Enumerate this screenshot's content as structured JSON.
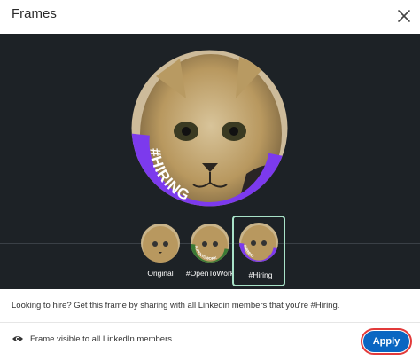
{
  "dialog": {
    "title": "Frames",
    "close_icon": "close-icon"
  },
  "preview": {
    "frame_text": "#HIRING",
    "frame_color": "#7c3aed"
  },
  "frames": [
    {
      "label": "Original",
      "selected": false
    },
    {
      "label": "#OpenToWork",
      "ring_text": "#OPENTOWORK",
      "selected": false
    },
    {
      "label": "#Hiring",
      "ring_text": "#HIRING",
      "selected": true
    }
  ],
  "description": "Looking to hire? Get this frame by sharing with all Linkedin members that you're #Hiring.",
  "footer": {
    "visibility_icon": "eye-icon",
    "visibility_text": "Frame visible to all LinkedIn members",
    "apply_label": "Apply"
  },
  "colors": {
    "accent": "#0a66c2",
    "dark_stage": "#1d2226",
    "selected_border": "#a8e2c8",
    "open_to_work": "#3b7a35",
    "hiring": "#7c3aed",
    "highlight_ring": "#e23a3a"
  }
}
